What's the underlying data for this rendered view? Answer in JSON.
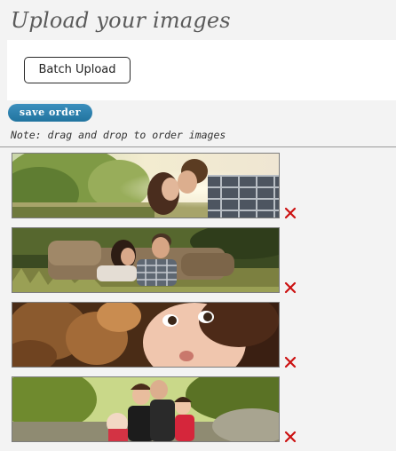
{
  "header": {
    "title": "Upload your images"
  },
  "upload": {
    "batch_label": "Batch Upload"
  },
  "actions": {
    "save_label": "save order"
  },
  "note": "Note: drag and drop to order images",
  "images": [
    {
      "subject": "couple-kissing-outdoors"
    },
    {
      "subject": "couple-on-couch-in-grass"
    },
    {
      "subject": "child-in-autumn-leaves"
    },
    {
      "subject": "family-on-rocks"
    }
  ],
  "colors": {
    "title": "#5a5a5a",
    "save_button": "#2a7fb0",
    "delete_icon": "#cc1111"
  },
  "icons": {
    "delete": "red-x-icon"
  }
}
